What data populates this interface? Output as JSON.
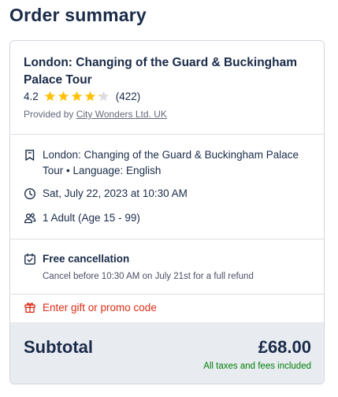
{
  "page": {
    "title": "Order summary"
  },
  "tour": {
    "title": "London: Changing of the Guard & Buckingham Palace Tour",
    "rating_value": "4.2",
    "rating": 4.2,
    "rating_max": 5,
    "review_count": "(422)",
    "provider_prefix": "Provided by",
    "provider_name": "City Wonders Ltd. UK"
  },
  "details": {
    "tour_language": "London: Changing of the Guard & Buckingham Palace Tour • Language: English",
    "datetime": "Sat, July 22, 2023 at 10:30 AM",
    "participants": "1 Adult (Age 15 - 99)"
  },
  "cancellation": {
    "title": "Free cancellation",
    "subtitle": "Cancel before 10:30 AM on July 21st for a full refund"
  },
  "promo": {
    "label": "Enter gift or promo code"
  },
  "subtotal": {
    "label": "Subtotal",
    "amount": "£68.00",
    "tax_note": "All taxes and fees included"
  },
  "colors": {
    "text": "#1a2b49",
    "star": "#ffc107",
    "promo": "#dc2d17",
    "tax_note": "#008009",
    "subtotal_bg": "#e8ebf0"
  },
  "icons": {
    "star": "star-icon",
    "language": "ticket-language-icon",
    "date": "clock-icon",
    "participants": "participants-icon",
    "cancellation": "calendar-check-icon",
    "promo": "gift-icon"
  }
}
